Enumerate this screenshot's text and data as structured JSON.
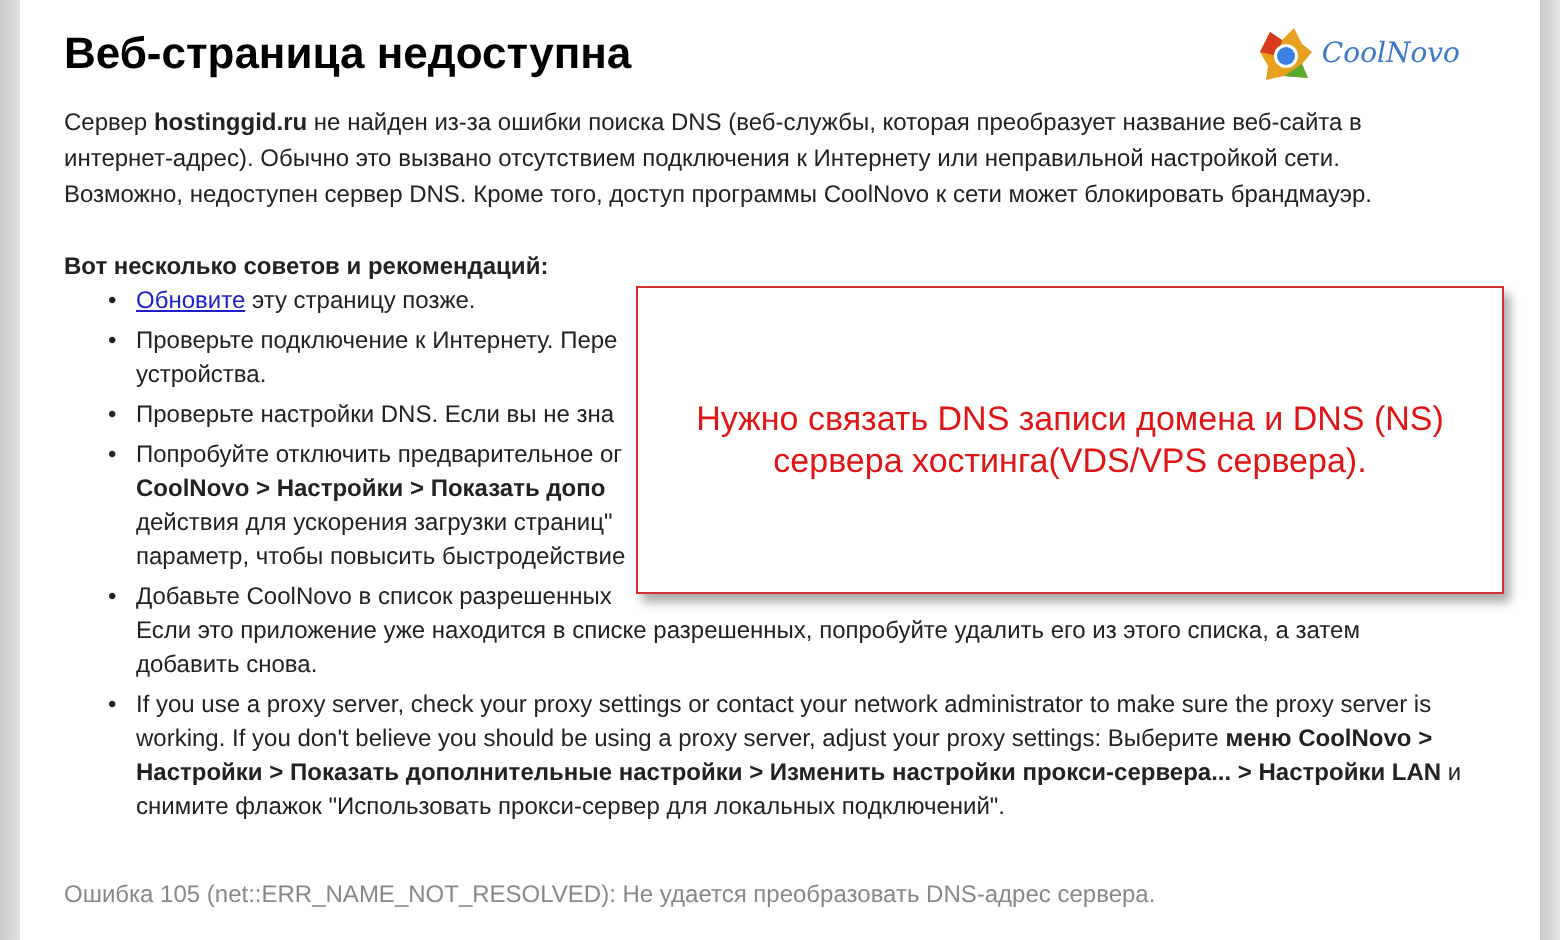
{
  "page": {
    "title": "Веб-страница недоступна",
    "logo_text": "CoolNovo"
  },
  "intro": "Сервер **hostinggid.ru** не найден из-за ошибки поиска DNS (веб-службы, которая преобразует название веб-сайта в интернет-адрес). Обычно это вызвано отсутствием подключения к Интернету или неправильной настройкой сети. Возможно, недоступен сервер DNS. Кроме того, доступ программы CoolNovo к сети может блокировать брандмауэр.",
  "tips_heading": "Вот несколько советов и рекомендаций:",
  "bullet": "•",
  "tips": [
    {
      "link": "Обновите",
      "lines": [
        " эту страницу позже."
      ]
    },
    {
      "lines": [
        "Проверьте подключение к Интернету. Пере",
        "устройства."
      ]
    },
    {
      "lines": [
        "Проверьте настройки DNS. Если вы не зна"
      ]
    },
    {
      "lines": [
        "Попробуйте отключить предварительное ог",
        "**CoolNovo > Настройки > Показать допо**",
        "действия для ускорения загрузки страниц\"",
        "параметр, чтобы повысить быстродействие"
      ]
    },
    {
      "lines": [
        "Добавьте CoolNovo в список разрешенных",
        "Если это приложение уже находится в списке разрешенных, попробуйте удалить его из этого списка, а затем",
        "добавить снова."
      ]
    },
    {
      "paragraph": "If you use a proxy server, check your proxy settings or contact your network administrator to make sure the proxy server is working. If you don't believe you should be using a proxy server, adjust your proxy settings: Выберите **меню CoolNovo > Настройки > Показать дополнительные настройки > Изменить настройки прокси-сервера... > Настройки LAN** и снимите флажок \"Использовать прокси-сервер для локальных подключений\"."
    }
  ],
  "error_code": "Ошибка 105 (net::ERR_NAME_NOT_RESOLVED): Не удается преобразовать DNS-адрес сервера.",
  "callout": "Нужно связать DNS записи домена и DNS (NS) сервера хостинга(VDS/VPS сервера)."
}
